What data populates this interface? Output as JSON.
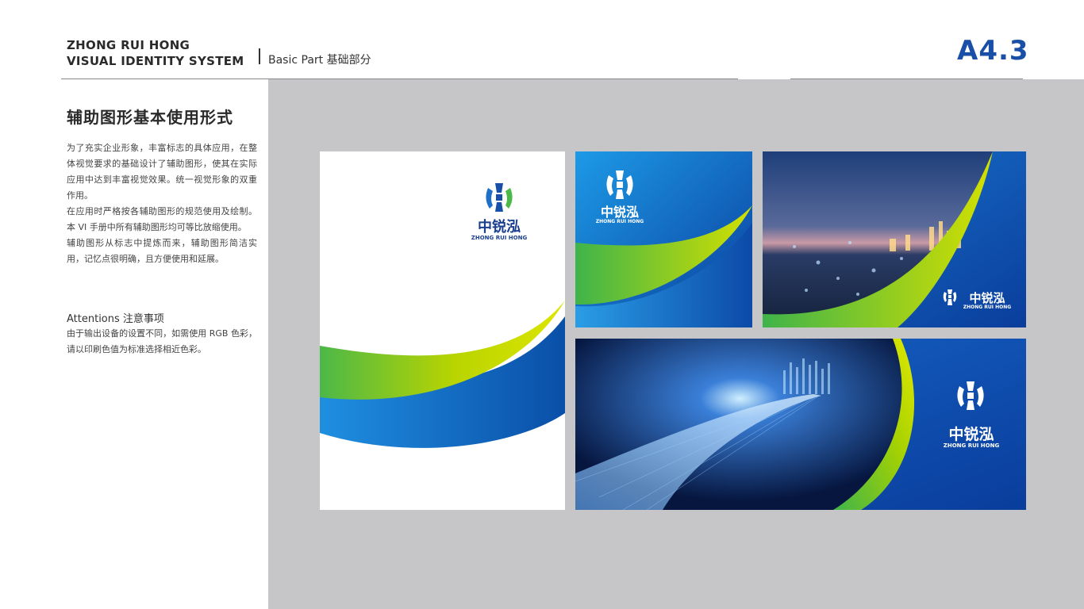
{
  "header": {
    "brand_line1": "ZHONG RUI HONG",
    "brand_line2": "VISUAL IDENTITY SYSTEM",
    "section": "Basic Part 基础部分",
    "page_number": "A4.3"
  },
  "left": {
    "title": "辅助图形基本使用形式",
    "paragraphs": [
      "为了充实企业形象，丰富标志的具体应用，在整体视觉要求的基础设计了辅助图形，使其在实际应用中达到丰富视觉效果。统一视觉形象的双重作用。",
      "在应用时严格按各辅助图形的规范使用及绘制。本 VI 手册中所有辅助图形均可等比放缩使用。",
      "辅助图形从标志中提炼而来，辅助图形简洁实用，记忆点很明确，且方便使用和延展。"
    ],
    "attention_title": "Attentions 注意事项",
    "attention_text": "由于输出设备的设置不同，如需使用 RGB 色彩，请以印刷色值为标准选择相近色彩。"
  },
  "logo": {
    "name_cn": "中锐泓",
    "name_en": "ZHONG RUI HONG"
  },
  "colors": {
    "brand_blue": "#1a4fa8",
    "deep_blue": "#0a3d9c",
    "green": "#4cb848",
    "yellow_green": "#cddc00",
    "panel_grey": "#c6c6c8"
  }
}
